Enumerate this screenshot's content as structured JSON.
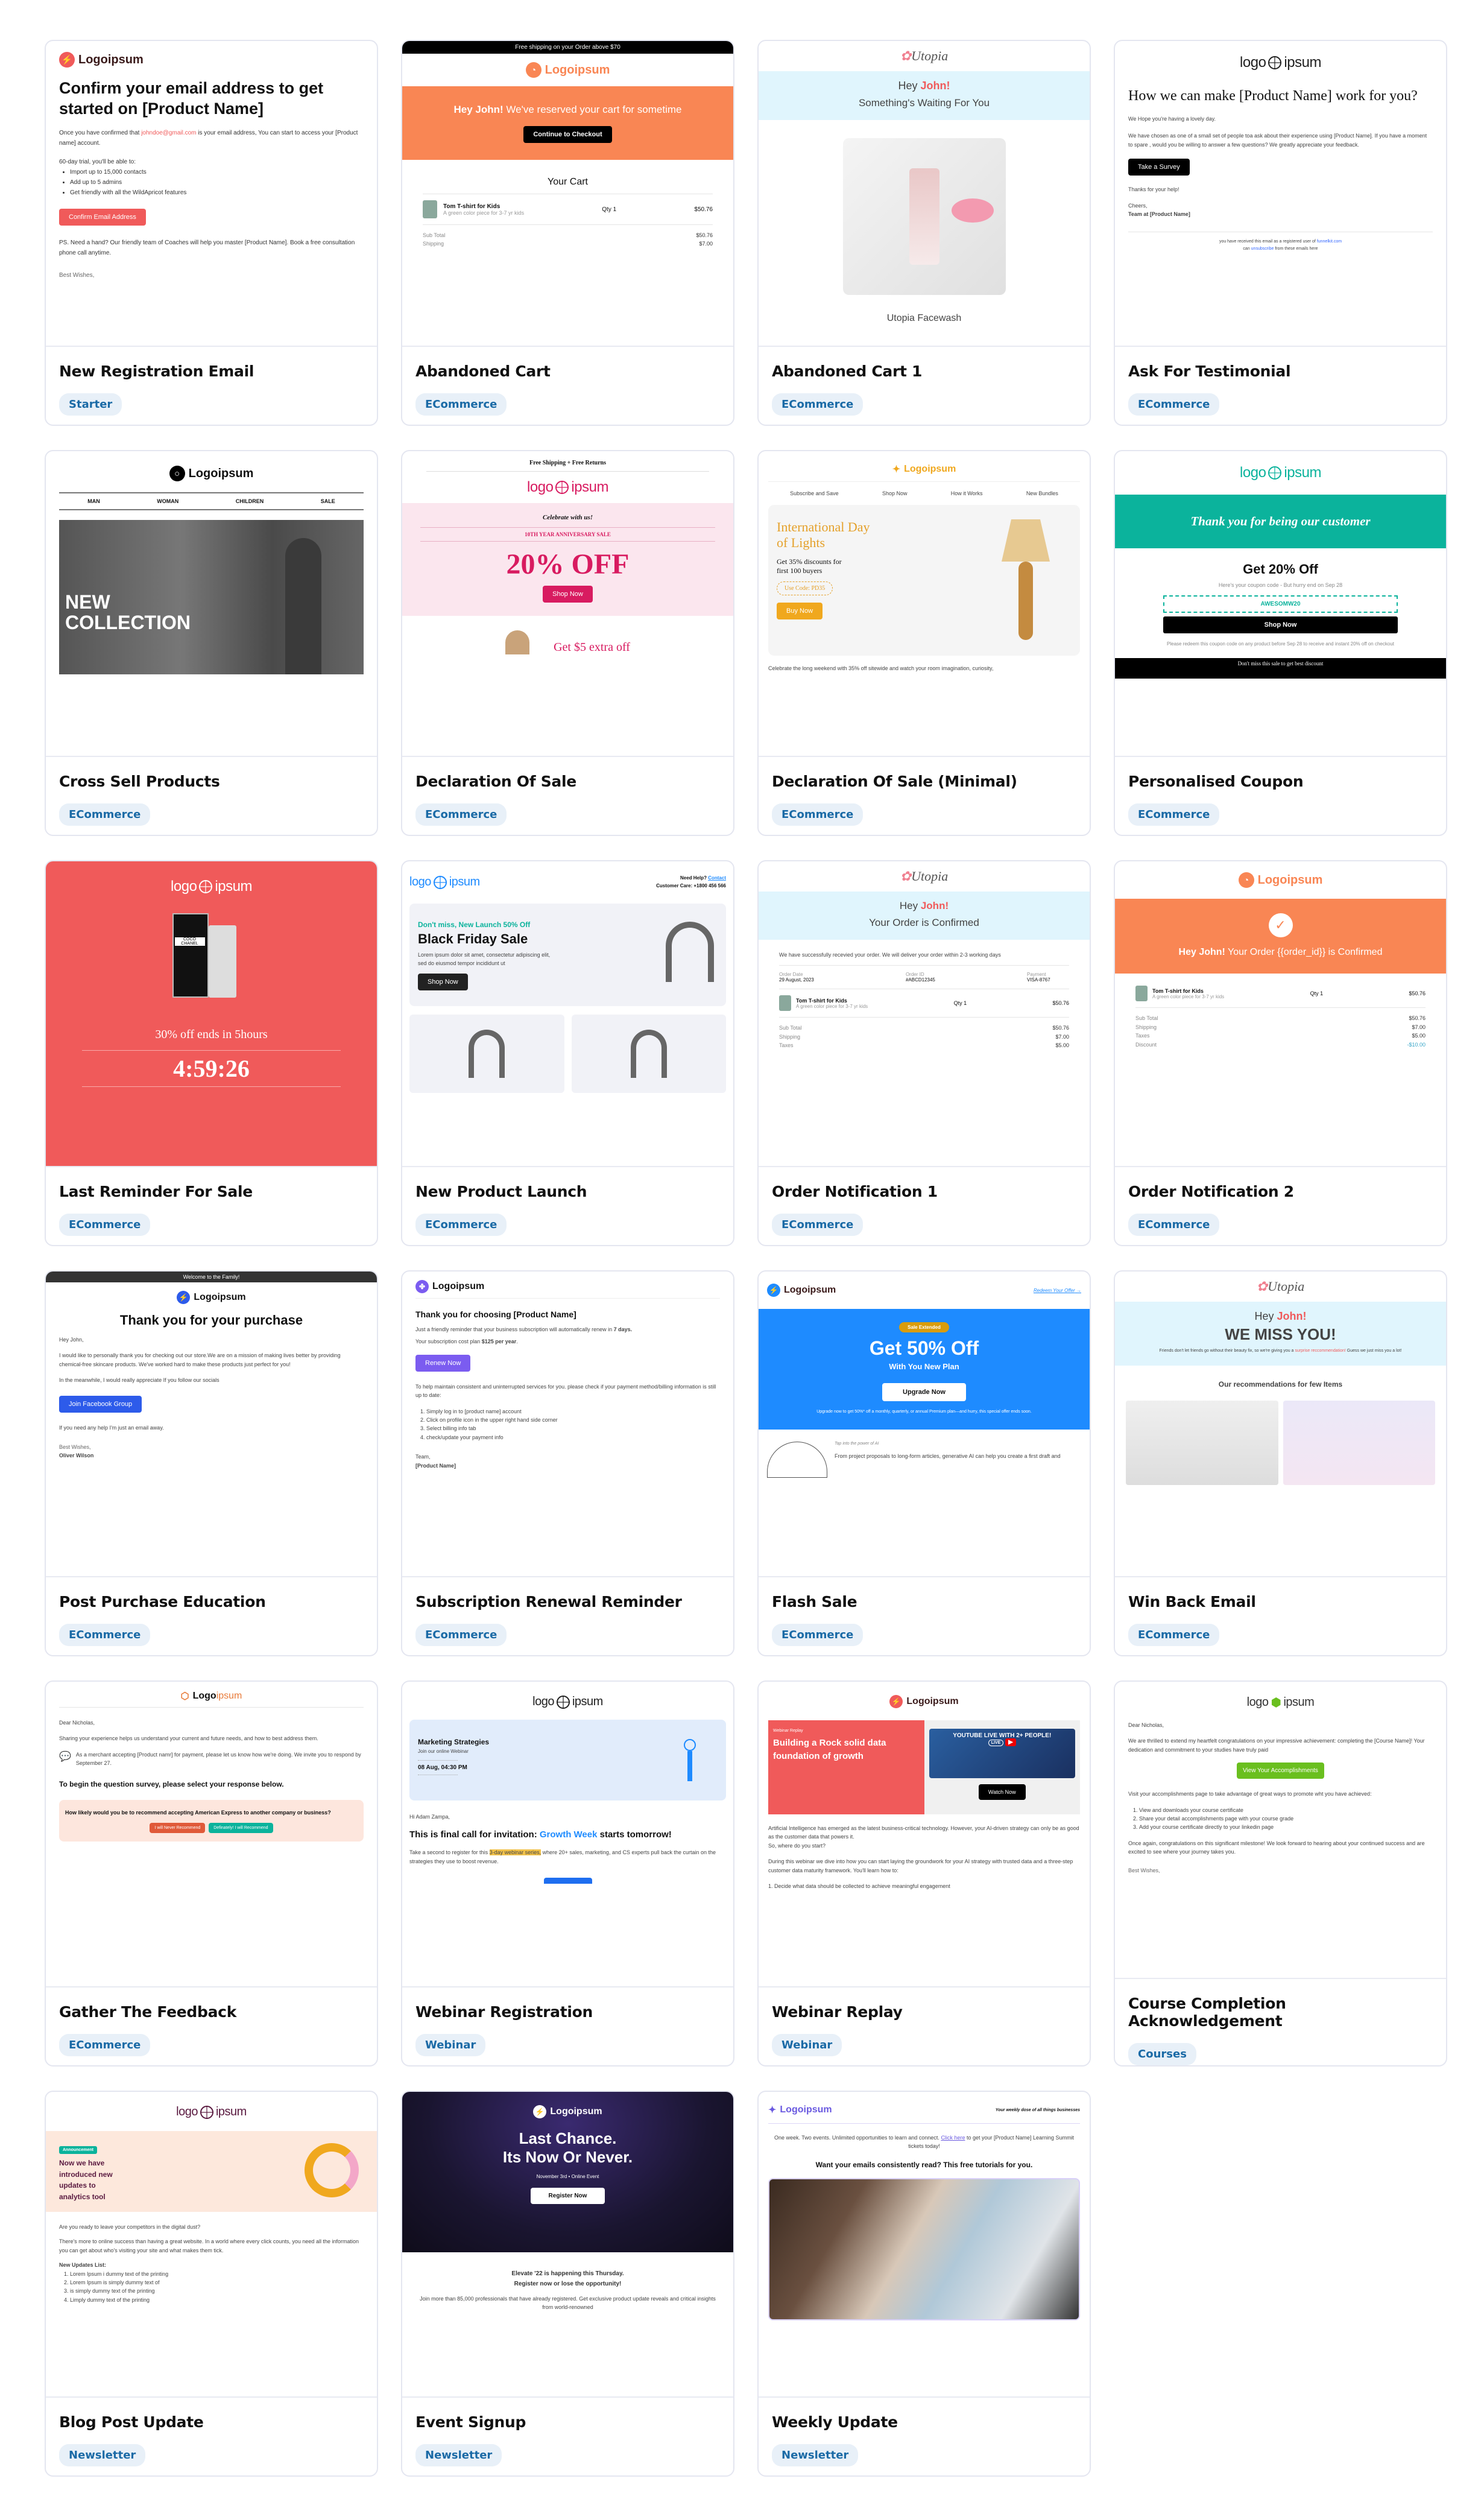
{
  "templates": [
    {
      "title": "New Registration Email",
      "tag": "Starter",
      "preview": {
        "logo": "Logoipsum",
        "heading": "Confirm your email address to get started on [Product Name]",
        "body_pre": "Once you have confirmed that ",
        "email": "johndoe@gmail.com",
        "body_post": " is  your email address, You can start to access your [Product name] account.",
        "trial_intro": "60-day trial, you'll be able to:",
        "bullets": [
          "Import up to 15,000 contacts",
          "Add up to 5 admins",
          "Get friendly with all the WildApricot features"
        ],
        "button": "Confirm Email Address",
        "ps": "PS. Need a hand? Our friendly team of Coaches will help you master [Product Name]. Book a free consultation phone call anytime.",
        "signoff": "Best Wishes,"
      }
    },
    {
      "title": "Abandoned Cart",
      "tag": "ECommerce",
      "preview": {
        "top_bar": "Free shipping on your Order above $70",
        "logo": "Logoipsum",
        "greeting_bold": "Hey John!",
        "greeting_rest": " We've reserved your cart for sometime",
        "button": "Continue to Checkout",
        "cart_heading": "Your Cart",
        "item_name": "Tom T-shirt for Kids",
        "item_desc": "A green color piece for 3-7 yr kids",
        "qty": "Qty 1",
        "price": "$50.76",
        "subtotal_label": "Sub Total",
        "subtotal": "$50.76",
        "shipping_label": "Shipping",
        "shipping": "$7.00"
      }
    },
    {
      "title": "Abandoned Cart 1",
      "tag": "ECommerce",
      "preview": {
        "logo": "Utopia",
        "hey": "Hey ",
        "name": "John!",
        "subtitle": "Something's Waiting For You",
        "product": "Utopia Facewash"
      }
    },
    {
      "title": "Ask For Testimonial",
      "tag": "ECommerce",
      "preview": {
        "logo_left": "logo",
        "logo_right": "ipsum",
        "heading": "How we can make [Product Name] work for you?",
        "p1": "We Hope you're having a lovely day.",
        "p2": "We have chosen as one of a small set of people toa ask about their  experience using [Product Name]. If you have a moment to spare , would you be willing to answer a few questions? We greatly appreciate your feedback.",
        "button": "Take a Survey",
        "thanks": "Thanks for your help!",
        "cheers": "Cheers,",
        "team": "Team at [Product Name]",
        "footer1": "you have received this email as a registered user of ",
        "footer_link": "funnelkit.com",
        "footer2a": "can ",
        "footer_unsub": "unsubscribe",
        "footer2b": " from these emails here"
      }
    },
    {
      "title": "Cross Sell Products",
      "tag": "ECommerce",
      "preview": {
        "logo": "Logoipsum",
        "nav": [
          "MAN",
          "WOMAN",
          "CHILDREN",
          "SALE"
        ],
        "hero_line1": "NEW",
        "hero_line2": "COLLECTION"
      }
    },
    {
      "title": "Declaration Of Sale",
      "tag": "ECommerce",
      "preview": {
        "top": "Free Shipping  +  Free Returns",
        "logo_left": "logo",
        "logo_right": "ipsum",
        "celebrate": "Celebrate with us!",
        "anniversary": "10TH YEAR ANNIVERSARY SALE",
        "discount": "20% OFF",
        "button": "Shop Now",
        "extra": "Get $5 extra off"
      }
    },
    {
      "title": "Declaration Of Sale (Minimal)",
      "tag": "ECommerce",
      "preview": {
        "logo": "Logoipsum",
        "nav": [
          "Subscribe and Save",
          "Shop Now",
          "How it Works",
          "New Bundles"
        ],
        "heading": "International Day of Lights",
        "offer": "Get 35% discounts for first 100 buyers",
        "code": "Use Code: PD35",
        "button": "Buy Now",
        "body": "Celebrate the long weekend with 35% off sitewide and watch your room imagination, curiosity,"
      }
    },
    {
      "title": "Personalised Coupon",
      "tag": "ECommerce",
      "preview": {
        "logo_left": "logo",
        "logo_right": "ipsum",
        "banner": "Thank you for being our customer",
        "heading": "Get 20% Off",
        "sub": "Here's your coupon code - But hurry end on  Sep 28",
        "code": "AWESOMW20",
        "button": "Shop Now",
        "note": "Please redeem this coupon code on any product before Sep 28 to receive and instant 20% off on checkout",
        "footer": "Don't miss this sale to get best discount"
      }
    },
    {
      "title": "Last Reminder For Sale",
      "tag": "ECommerce",
      "preview": {
        "logo_left": "logo",
        "logo_right": "ipsum",
        "product_label": "COCO CHANEL",
        "offer": "30% off ends in 5hours",
        "timer": "4:59:26"
      }
    },
    {
      "title": "New Product Launch",
      "tag": "ECommerce",
      "preview": {
        "logo_left": "logo",
        "logo_right": "ipsum",
        "help": "Need Help? ",
        "contact": "Contact",
        "care": "Customer Care: +1800 456 566",
        "kicker": "Don't miss, New Launch 50% Off",
        "heading": "Black Friday Sale",
        "body": "Lorem ipsum dolor sit amet, consectetur adipiscing elit, sed do eiusmod tempor incididunt ut",
        "button": "Shop Now"
      }
    },
    {
      "title": "Order Notification 1",
      "tag": "ECommerce",
      "preview": {
        "logo": "Utopia",
        "hey": "Hey ",
        "name": "John!",
        "subtitle": "Your Order is Confirmed",
        "body": "We have successfully recevied your order. We will deliver your order within 2-3 working days",
        "meta": [
          {
            "label": "Order Date",
            "value": "29 August, 2023"
          },
          {
            "label": "Order ID",
            "value": "#ABCD12345"
          },
          {
            "label": "Payment",
            "value": "VISA-8767"
          }
        ],
        "item_name": "Tom T-shirt for Kids",
        "item_desc": "A green color piece for 3-7 yr kids",
        "qty": "Qty 1",
        "price": "$50.76",
        "totals": [
          {
            "label": "Sub Total",
            "value": "$50.76"
          },
          {
            "label": "Shipping",
            "value": "$7.00"
          },
          {
            "label": "Taxes",
            "value": "$5.00"
          }
        ]
      }
    },
    {
      "title": "Order Notification 2",
      "tag": "ECommerce",
      "preview": {
        "logo": "Logoipsum",
        "greeting_bold": "Hey John!",
        "greeting_rest": " Your Order {{order_id}} is Confirmed",
        "item_name": "Tom T-shirt for Kids",
        "item_desc": "A green color piece for 3-7 yr kids",
        "qty": "Qty 1",
        "price": "$50.76",
        "totals": [
          {
            "label": "Sub Total",
            "value": "$50.76"
          },
          {
            "label": "Shipping",
            "value": "$7.00"
          },
          {
            "label": "Taxes",
            "value": "$5.00"
          },
          {
            "label": "Discount",
            "value": "-$10.00"
          }
        ]
      }
    },
    {
      "title": "Post Purchase Education",
      "tag": "ECommerce",
      "preview": {
        "top_bar": "Welcome to the Family!",
        "logo": "Logoipsum",
        "heading": "Thank you for your purchase",
        "hey": "Hey John,",
        "p1": "I would like to personally thank you for checking out our store.We are on a mission of making lives better by providing chemical-free skincare products. We've worked hard to make these products just perfect for you!",
        "p2": "In the meanwhile, I would really appreciate If you follow our socials",
        "button": "Join Facebook Group",
        "p3": "If you need any help I'm just an email away.",
        "signoff": "Best Wishes,",
        "sender": "Oliver Wilson"
      }
    },
    {
      "title": "Subscription Renewal Reminder",
      "tag": "ECommerce",
      "preview": {
        "logo": "Logoipsum",
        "heading": "Thank you for choosing [Product Name]",
        "p1_pre": "Just a friendly reminder that your business subscription will automatically renew in ",
        "p1_bold": "7 days.",
        "p2_pre": "Your subscription cost plan ",
        "p2_bold": "$125 per year",
        "button": "Renew Now",
        "p3": "To help maintain consistent and uninterrupted services for you. please check if your payment method/billing information is still up to date:",
        "steps": [
          "Simply log in to [product name] account",
          "Click on profile icon in the upper right hand side corner",
          "Select billing info tab",
          "check/update your payment info"
        ],
        "signoff": "Team,",
        "sender": "[Product Name]"
      }
    },
    {
      "title": "Flash Sale",
      "tag": "ECommerce",
      "preview": {
        "logo": "Logoipsum",
        "redeem": "Redeem Your Offer",
        "badge": "Sale Extended",
        "heading": "Get 50% Off",
        "sub": "With You New Plan",
        "button": "Upgrade Now",
        "note": "Upgrade now to get 50%* off a monthly, quarterly, or annual Premium plan—and hurry, this special offer ends soon.",
        "kicker": "Tap into the power of AI",
        "body": "From project proposals to long-form articles, generative AI can help you create a first draft and"
      }
    },
    {
      "title": "Win Back Email",
      "tag": "ECommerce",
      "preview": {
        "logo": "Utopia",
        "hey": "Hey ",
        "name": "John!",
        "heading": "WE MISS YOU!",
        "body_pre": "Friends don't let friends go without their beauty fix, so we're giving you a ",
        "body_link": "surprise reccommendation!",
        "body_post": " Guess we just miss you a lot!",
        "rec": "Our recommendations for few Items"
      }
    },
    {
      "title": "Gather The Feedback",
      "tag": "ECommerce",
      "preview": {
        "logo_a": "Logo",
        "logo_b": "ipsum",
        "dear": "Dear Nicholas,",
        "p1": "Sharing your experience helps us understand your current and future needs, and how to best address them.",
        "p2": "As a merchant accepting [Product namr] for payment, please let us know how we're doing. We invite you to respond by September 27.",
        "heading": "To begin the question survey, please select your response below.",
        "question": "How likely would you be to recommend accepting American Express to another company or business?",
        "btn_no": "I will Never Recommend",
        "btn_yes": "Definately! I will Recommend"
      }
    },
    {
      "title": "Webinar Registration",
      "tag": "Webinar",
      "preview": {
        "logo_left": "logo",
        "logo_right": "ipsum",
        "event": "Marketing Strategies",
        "join": "Join our online Webinar",
        "date": "08 Aug, 04:30 PM",
        "hi": "Hi Adam Zampa,",
        "heading_pre": "This is final call for invitation: ",
        "heading_link": "Growth Week",
        "heading_post": " starts tomorrow!",
        "body_pre": "Take a second to register for this ",
        "body_hl": "3-day webinar series,",
        "body_post": " where 20+ sales, marketing, and CS experts pull back the curtain on the strategies they use to boost revenue."
      }
    },
    {
      "title": "Webinar Replay",
      "tag": "Webinar",
      "preview": {
        "logo": "Logoipsum",
        "kicker": "Webinar Replay",
        "heading": "Building a Rock solid data foundation of growth",
        "video_text": "YOUTUBE LIVE WITH 2+ PEOPLE!",
        "live": "LIVE",
        "button": "Watch Now",
        "p1": "Artificial Intelligence has emerged as the latest business-critical technology. However, your AI-driven strategy can only be as good as the customer data that powers it.",
        "p1b": "So, where do you start?",
        "p2": "During this webinar we dive into how you can start laying the groundwork for your AI strategy with trusted data and a three-step customer data maturity framework. You'll learn how to:",
        "step": "1. Decide what data should be collected to achieve meaningful engagement"
      }
    },
    {
      "title": "Course Completion Acknowledgement",
      "tag": "Courses",
      "preview": {
        "logo_left": "logo",
        "logo_right": "ipsum",
        "dear": "Dear Nicholas,",
        "p1": "We are thrilled to extend my heartfelt congratulations on your impressive achievement: completing the [Course Name]! Your dedication and commitment to your studies have truly paid",
        "button": "View Your Accomplishments",
        "p2": "Visit your accomplishments page to take advantage of great ways to promote wht you have achieved:",
        "steps": [
          "View and downloads your course certificate",
          "Share your detail accomplishments page with your course grade",
          "Add your course certificate directly to your linkedin page"
        ],
        "p3": "Once again, congratulations on this significant milestone! We look forward to hearing about your continued success and are excited to see where your journey takes you.",
        "signoff": "Best Wishes,"
      }
    },
    {
      "title": "Blog Post Update",
      "tag": "Newsletter",
      "preview": {
        "logo_left": "logo",
        "logo_right": "ipsum",
        "badge": "Announcement",
        "heading": "Now we have introduced new updates to analytics tool",
        "p1": "Are you ready to leave your competitors in the digital dust?",
        "p2": "There's more to online success than having a great website. In a world where every click counts, you need all the information you can get about who's visiting your site and what makes them tick.",
        "list_title": "New Updates List:",
        "list": [
          "Lorem Ipsum i dummy text of the printing",
          "Lorem Ipsum is simply dummy text of",
          " is simply dummy text of the printing",
          "Limply dummy text of the printing"
        ]
      }
    },
    {
      "title": "Event Signup",
      "tag": "Newsletter",
      "preview": {
        "logo": "Logoipsum",
        "heading1": "Last Chance.",
        "heading2": "Its Now Or Never.",
        "date": "November 3rd",
        "type": "Online Event",
        "button": "Register Now",
        "b1": "Elevate '22 is happening this Thursday.",
        "b2": "Register now or lose the opportunity!",
        "p": "Join more than 85,000 professionals that have already registered. Get exclusive product update reveals and critical insights from world-renowned"
      }
    },
    {
      "title": "Weekly Update",
      "tag": "Newsletter",
      "preview": {
        "logo": "Logoipsum",
        "tagline": "Your weekly dose of all things businesses",
        "p_pre": "One week. Two events. Unlimited opportunities to learn and connect. ",
        "p_link": "Click here",
        "p_post": " to get your [Product Name] Learning Summit tickets today!",
        "heading": "Want your emails consistently read? This free tutorials for you."
      }
    }
  ],
  "colors": {
    "tag_bg": "#e8f0f8",
    "tag_text": "#1a6aa6",
    "card_border": "#e4e6f0",
    "coral": "#f05a5a",
    "orange": "#f98654",
    "teal": "#0bb39c",
    "pink": "#d81b60",
    "blue": "#1e8bff",
    "purple": "#7b5cf0",
    "green": "#6abf1f"
  }
}
